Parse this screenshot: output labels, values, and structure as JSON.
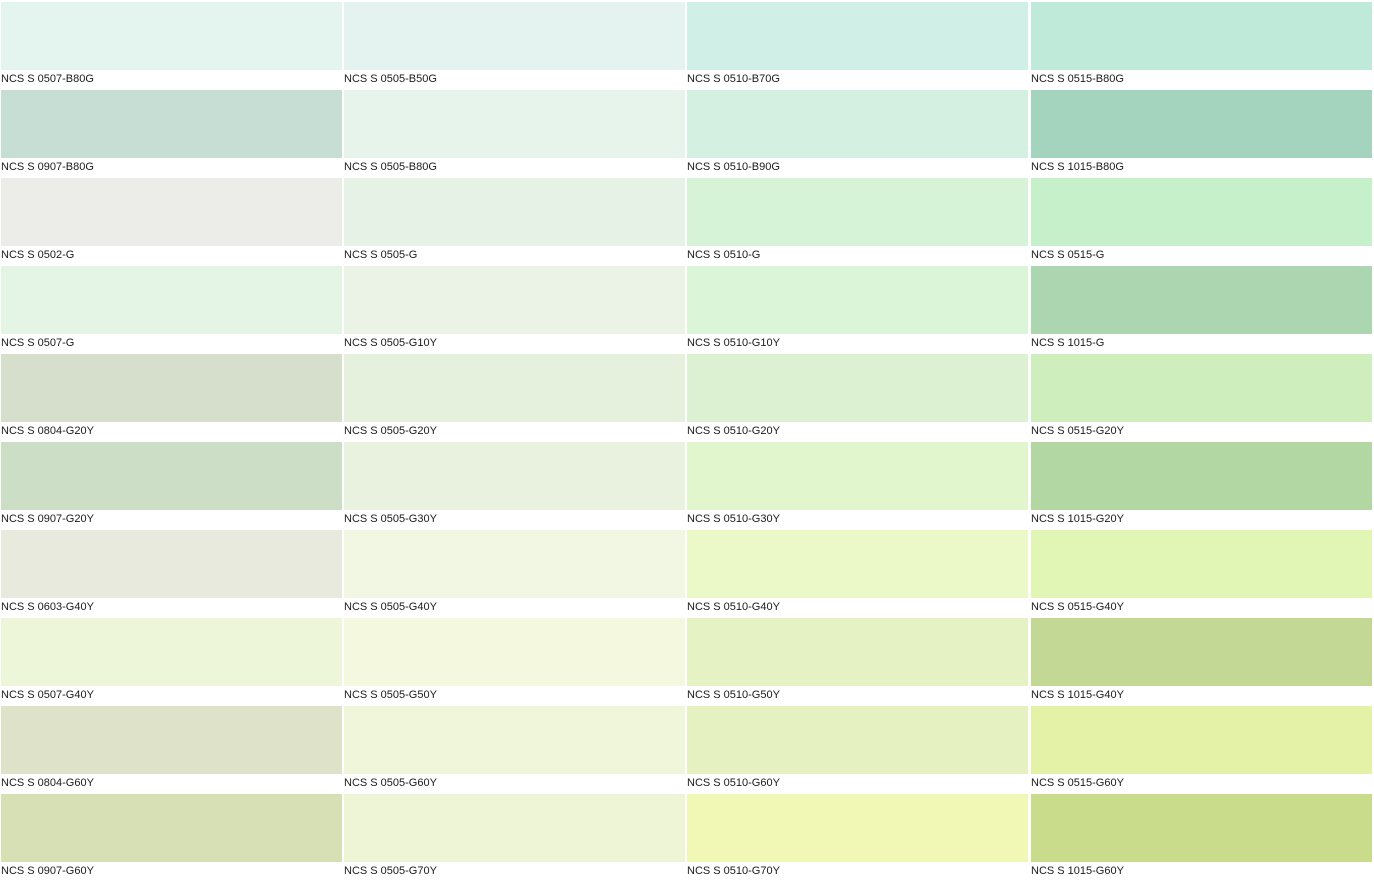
{
  "swatches": [
    {
      "code": "NCS S 0507-B80G",
      "color": "#e3f5ee"
    },
    {
      "code": "NCS S 0505-B50G",
      "color": "#e5f3f0"
    },
    {
      "code": "NCS S 0510-B70G",
      "color": "#d0efe7"
    },
    {
      "code": "NCS S 0515-B80G",
      "color": "#bfeada"
    },
    {
      "code": "NCS S 0907-B80G",
      "color": "#c7ded5"
    },
    {
      "code": "NCS S 0505-B80G",
      "color": "#e6f4ec"
    },
    {
      "code": "NCS S 0510-B90G",
      "color": "#d4f0e1"
    },
    {
      "code": "NCS S 1015-B80G",
      "color": "#a4d3be"
    },
    {
      "code": "NCS S 0502-G",
      "color": "#ecede8"
    },
    {
      "code": "NCS S 0505-G",
      "color": "#e6f2e6"
    },
    {
      "code": "NCS S 0510-G",
      "color": "#d6f3d8"
    },
    {
      "code": "NCS S 0515-G",
      "color": "#c6f0ca"
    },
    {
      "code": "NCS S 0507-G",
      "color": "#e4f5e5"
    },
    {
      "code": "NCS S 0505-G10Y",
      "color": "#ebf3e6"
    },
    {
      "code": "NCS S 0510-G10Y",
      "color": "#dbf5d8"
    },
    {
      "code": "NCS S 1015-G",
      "color": "#abd6af"
    },
    {
      "code": "NCS S 0804-G20Y",
      "color": "#d6dfcc"
    },
    {
      "code": "NCS S 0505-G20Y",
      "color": "#e6f1dd"
    },
    {
      "code": "NCS S 0510-G20Y",
      "color": "#dbf1d2"
    },
    {
      "code": "NCS S 0515-G20Y",
      "color": "#cfeebd"
    },
    {
      "code": "NCS S 0907-G20Y",
      "color": "#ccdec5"
    },
    {
      "code": "NCS S 0505-G30Y",
      "color": "#e9f2de"
    },
    {
      "code": "NCS S 0510-G30Y",
      "color": "#e1f6cd"
    },
    {
      "code": "NCS S 1015-G20Y",
      "color": "#b3d7a2"
    },
    {
      "code": "NCS S 0603-G40Y",
      "color": "#e8eadd"
    },
    {
      "code": "NCS S 0505-G40Y",
      "color": "#f1f7e3"
    },
    {
      "code": "NCS S 0510-G40Y",
      "color": "#ebf9c9"
    },
    {
      "code": "NCS S 0515-G40Y",
      "color": "#e1f5b4"
    },
    {
      "code": "NCS S 0507-G40Y",
      "color": "#eef6d9"
    },
    {
      "code": "NCS S 0505-G50Y",
      "color": "#f4f8df"
    },
    {
      "code": "NCS S 0510-G50Y",
      "color": "#e5f2c4"
    },
    {
      "code": "NCS S 1015-G40Y",
      "color": "#c4d896"
    },
    {
      "code": "NCS S 0804-G60Y",
      "color": "#dee2c8"
    },
    {
      "code": "NCS S 0505-G60Y",
      "color": "#eff6da"
    },
    {
      "code": "NCS S 0510-G60Y",
      "color": "#e5f1c0"
    },
    {
      "code": "NCS S 0515-G60Y",
      "color": "#e3f2a6"
    },
    {
      "code": "NCS S 0907-G60Y",
      "color": "#d7dfb5"
    },
    {
      "code": "NCS S 0505-G70Y",
      "color": "#edf5d6"
    },
    {
      "code": "NCS S 0510-G70Y",
      "color": "#f1f7b4"
    },
    {
      "code": "NCS S 1015-G60Y",
      "color": "#c9dc8b"
    }
  ]
}
